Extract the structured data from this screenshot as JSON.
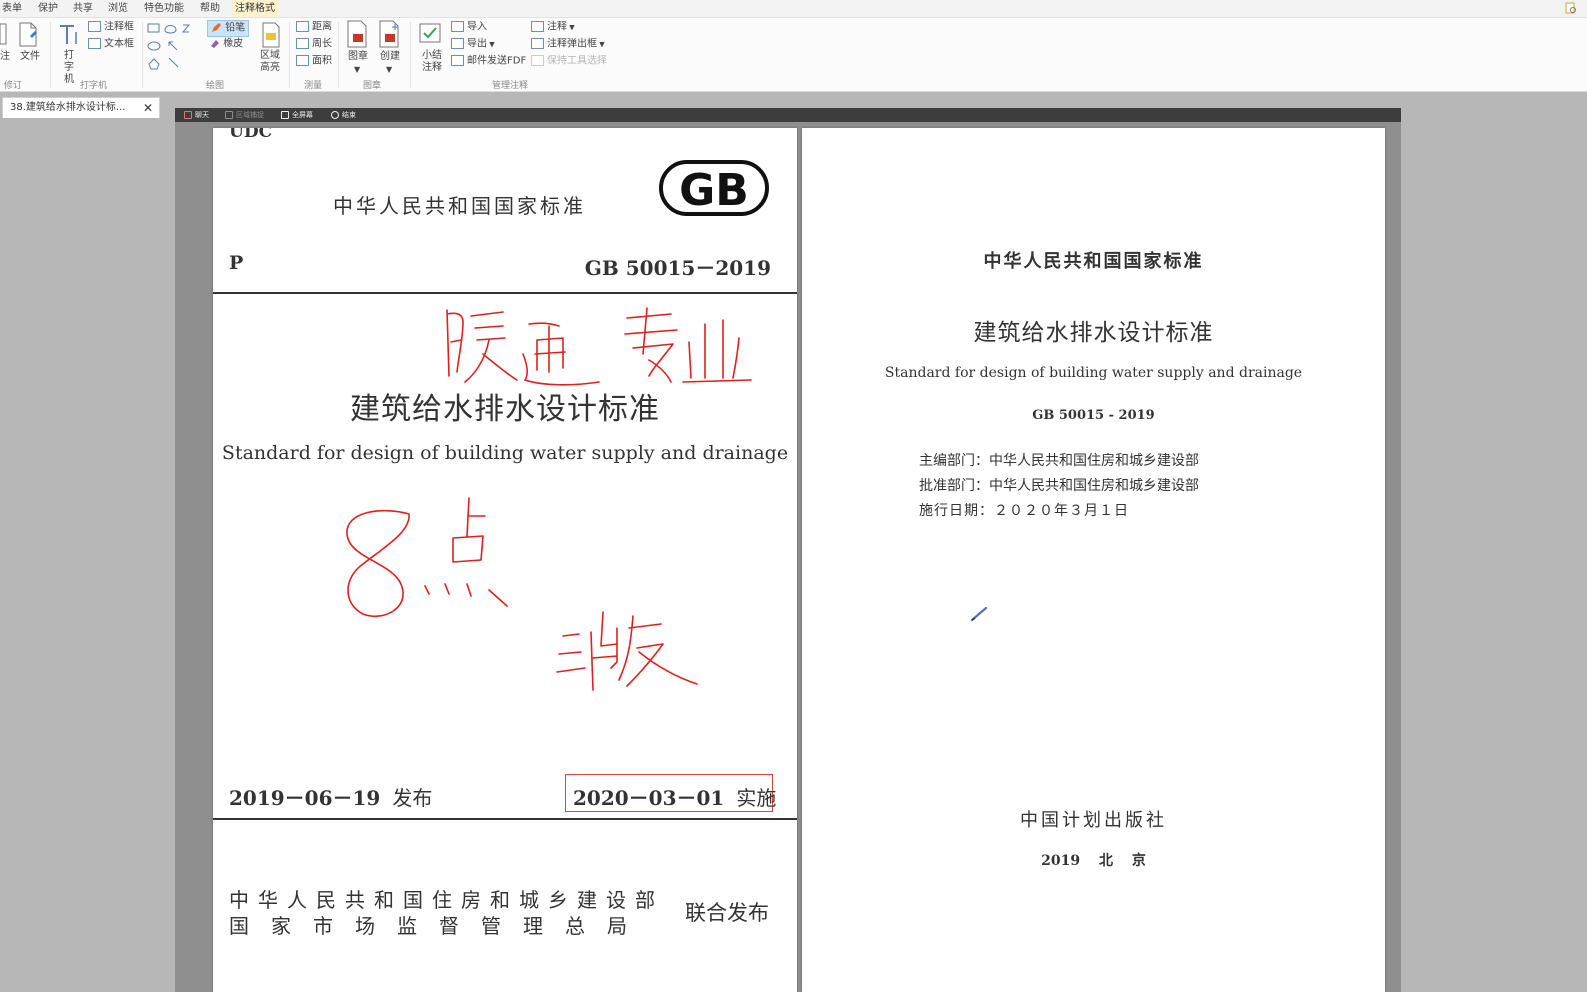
{
  "menubar": {
    "items": [
      "表单",
      "保护",
      "共享",
      "浏览",
      "特色功能",
      "帮助",
      "注释格式"
    ],
    "active_index": 6
  },
  "ribbon": {
    "file_btn": "文件",
    "typewriter": "打字机",
    "note_box": "注释框",
    "text_box": "文本框",
    "pencil": "铅笔",
    "eraser": "橡皮",
    "area_highlight": "区域高亮",
    "distance": "距离",
    "perimeter": "周长",
    "area": "面积",
    "stamp": "图章",
    "create": "创建",
    "summary": "小结注释",
    "import": "导入",
    "export": "导出",
    "email_pdf": "邮件发送FDF",
    "annotate": "注释",
    "annotation_popup": "注释弹出框",
    "keep_tool": "保持工具选择",
    "groups": {
      "g1": "修订",
      "g2": "打字机",
      "g3": "绘图",
      "g4": "测量",
      "g5": "图章",
      "g6": "管理注释"
    }
  },
  "tab": {
    "title": "38.建筑给水排水设计标...",
    "close": "✕"
  },
  "viewer_toolbar": {
    "chat": "聊天",
    "select_region": "区域捕捉",
    "fullscreen": "全屏幕",
    "end": "结束"
  },
  "cover": {
    "udc": "UDC",
    "header": "中华人民共和国国家标准",
    "logo": "GB",
    "class_code": "P",
    "standard_no": "GB 50015－2019",
    "title_cn": "建筑给水排水设计标准",
    "title_en": "Standard for design of building water supply and drainage",
    "publish_date": "2019－06－19",
    "publish_label": "发布",
    "effective_date": "2020－03－01",
    "effective_label": "实施",
    "issuer_1": "中华人民共和国住房和城乡建设部",
    "issuer_2": "国家市场监督管理总局",
    "joint_label": "联合发布"
  },
  "ink": {
    "line1": "暖通专业",
    "line2": "8点",
    "line3": "三版",
    "color": "#e02020"
  },
  "title_page": {
    "header": "中华人民共和国国家标准",
    "title_cn": "建筑给水排水设计标准",
    "title_en": "Standard for design of building water supply and drainage",
    "standard_no": "GB 50015 - 2019",
    "editor_dept": "主编部门：中华人民共和国住房和城乡建设部",
    "approve_dept": "批准部门：中华人民共和国住房和城乡建设部",
    "effective": "施行日期：２０２０年３月１日",
    "publisher": "中国计划出版社",
    "place": "2019 北 京"
  }
}
